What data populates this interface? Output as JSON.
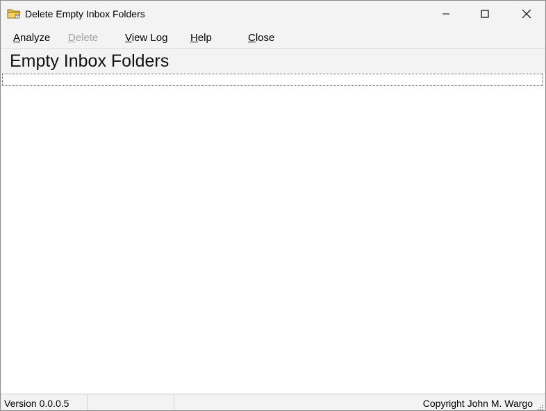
{
  "window": {
    "title": "Delete Empty Inbox Folders",
    "icon": "folder-icon"
  },
  "caption_buttons": {
    "minimize": "minimize-icon",
    "maximize": "maximize-icon",
    "close": "close-icon"
  },
  "menu": {
    "analyze": {
      "accel": "A",
      "rest": "nalyze",
      "enabled": true
    },
    "delete": {
      "accel": "D",
      "rest": "elete",
      "enabled": false
    },
    "view_log": {
      "accel": "V",
      "rest": "iew Log",
      "enabled": true
    },
    "help": {
      "accel": "H",
      "rest": "elp",
      "enabled": true
    },
    "close": {
      "accel": "C",
      "rest": "lose",
      "enabled": true
    }
  },
  "header": {
    "title": "Empty Inbox Folders"
  },
  "status": {
    "version": "Version 0.0.0.5",
    "copyright": "Copyright John M. Wargo"
  },
  "colors": {
    "chrome": "#f3f3f3",
    "disabled_text": "#a0a0a0",
    "folder_icon": "#f0c040"
  }
}
